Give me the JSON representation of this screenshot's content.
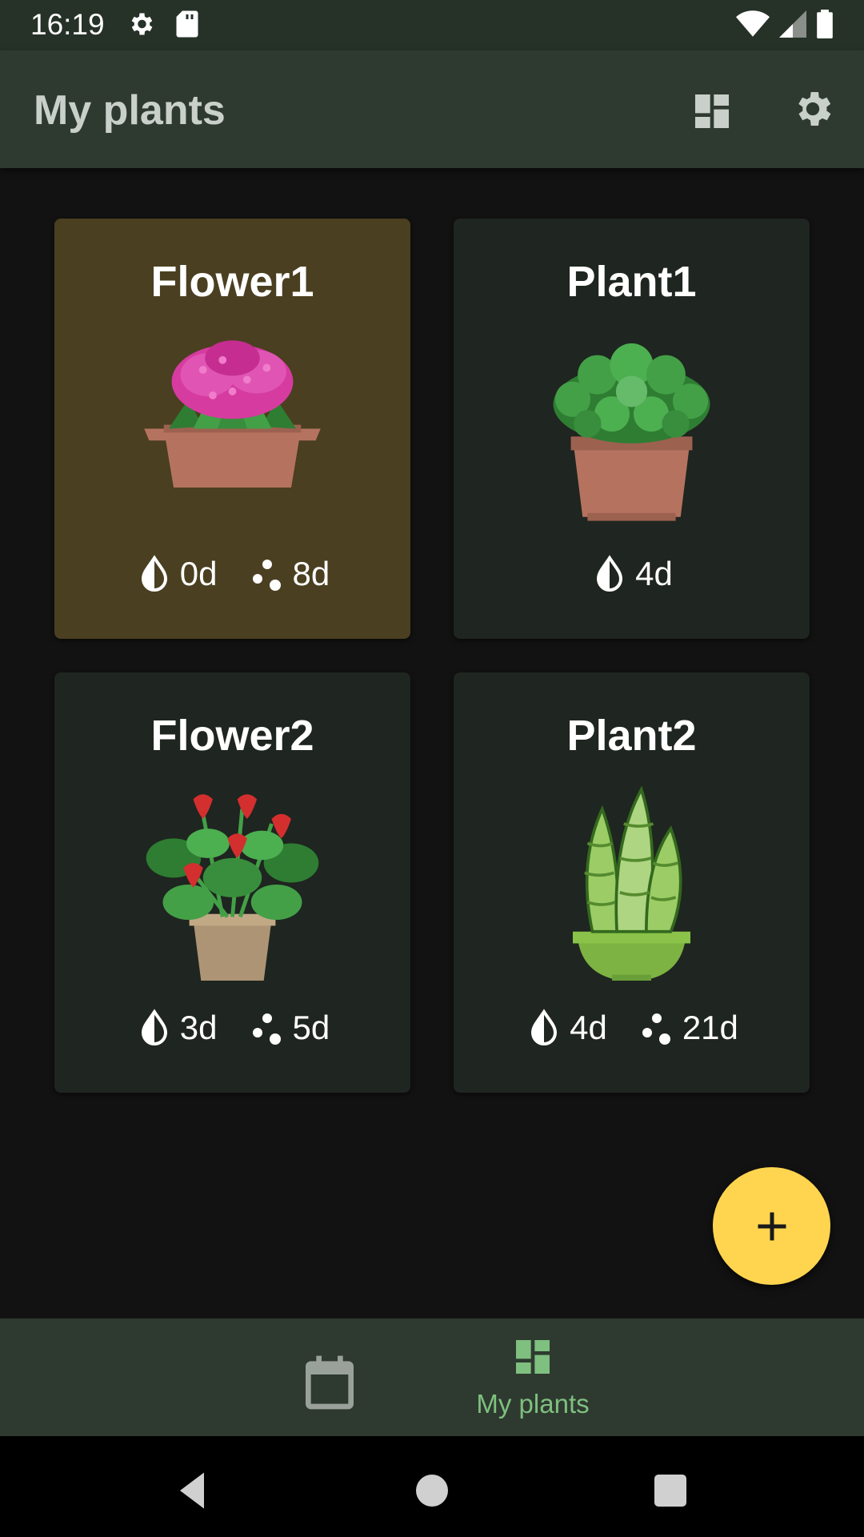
{
  "status_bar": {
    "time": "16:19",
    "left_icons": [
      "settings-icon",
      "sd-card-icon"
    ],
    "right_icons": [
      "wifi-icon",
      "signal-icon",
      "battery-icon"
    ]
  },
  "app_bar": {
    "title": "My plants",
    "actions": [
      "dashboard-layout-icon",
      "settings-icon"
    ]
  },
  "plants": [
    {
      "name": "Flower1",
      "art": "pink-hydrangea",
      "highlighted": true,
      "water": "0d",
      "fertilize": "8d"
    },
    {
      "name": "Plant1",
      "art": "green-bush",
      "highlighted": false,
      "water": "4d",
      "fertilize": null
    },
    {
      "name": "Flower2",
      "art": "red-anthurium",
      "highlighted": false,
      "water": "3d",
      "fertilize": "5d"
    },
    {
      "name": "Plant2",
      "art": "snake-plant",
      "highlighted": false,
      "water": "4d",
      "fertilize": "21d"
    }
  ],
  "fab": {
    "icon": "plus-icon"
  },
  "bottom_nav": {
    "items": [
      {
        "icon": "calendar-icon",
        "label": ""
      },
      {
        "icon": "dashboard-icon",
        "label": "My plants",
        "active": true
      }
    ]
  },
  "system_nav": [
    "back-icon",
    "home-icon",
    "recents-icon"
  ],
  "colors": {
    "highlight_card": "#4a3f20",
    "card": "#1f2520",
    "app_bar": "#2e3a30",
    "fab": "#ffd54f",
    "nav_active": "#7fbf7f"
  }
}
